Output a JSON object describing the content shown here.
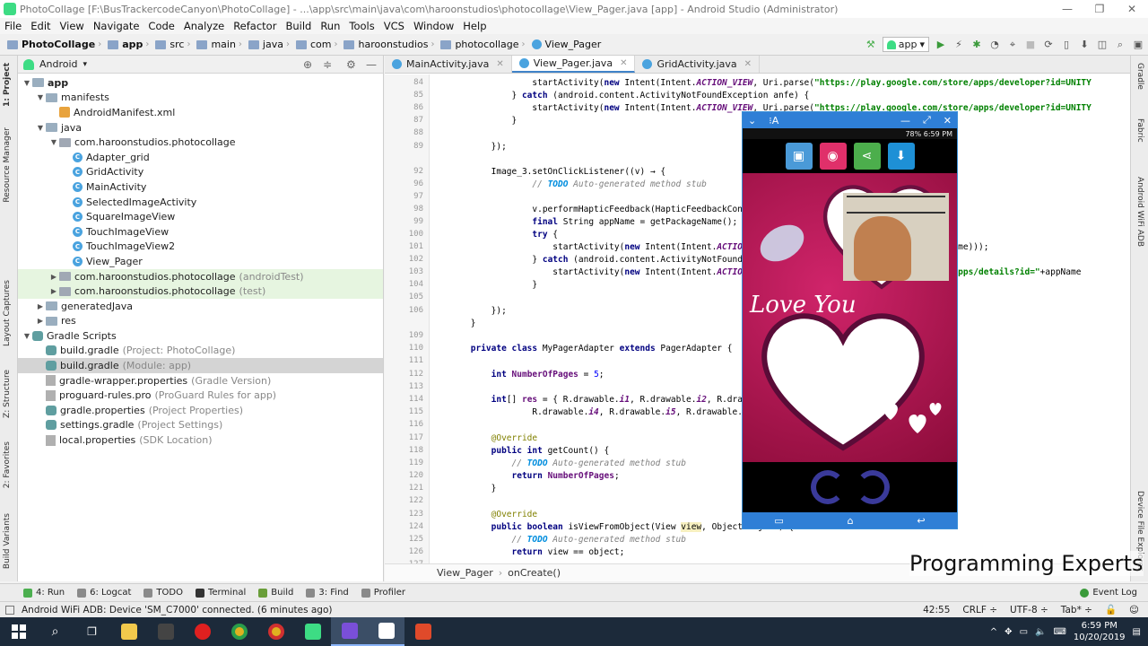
{
  "window": {
    "title": "PhotoCollage [F:\\BusTrackercodeCanyon\\PhotoCollage] - ...\\app\\src\\main\\java\\com\\haroonstudios\\photocollage\\View_Pager.java [app] - Android Studio (Administrator)",
    "controls": [
      "—",
      "❐",
      "✕"
    ]
  },
  "menu": [
    "File",
    "Edit",
    "View",
    "Navigate",
    "Code",
    "Analyze",
    "Refactor",
    "Build",
    "Run",
    "Tools",
    "VCS",
    "Window",
    "Help"
  ],
  "breadcrumb": [
    "PhotoCollage",
    "app",
    "src",
    "main",
    "java",
    "com",
    "haroonstudios",
    "photocollage",
    "View_Pager"
  ],
  "run_config": "app",
  "left_tabs": [
    "1: Project",
    "Resource Manager",
    "Layout Captures",
    "Z: Structure",
    "2: Favorites",
    "Build Variants"
  ],
  "right_tabs": [
    "Gradle",
    "Fabric",
    "Android WiFi ADB",
    "Device File Explorer"
  ],
  "project": {
    "view": "Android",
    "tree": [
      {
        "label": "app",
        "depth": 0,
        "type": "folder",
        "bold": true
      },
      {
        "label": "manifests",
        "depth": 1,
        "type": "folder"
      },
      {
        "label": "AndroidManifest.xml",
        "depth": 2,
        "type": "xml"
      },
      {
        "label": "java",
        "depth": 1,
        "type": "folder"
      },
      {
        "label": "com.haroonstudios.photocollage",
        "depth": 2,
        "type": "package"
      },
      {
        "label": "Adapter_grid",
        "depth": 3,
        "type": "class"
      },
      {
        "label": "GridActivity",
        "depth": 3,
        "type": "class"
      },
      {
        "label": "MainActivity",
        "depth": 3,
        "type": "class"
      },
      {
        "label": "SelectedImageActivity",
        "depth": 3,
        "type": "class"
      },
      {
        "label": "SquareImageView",
        "depth": 3,
        "type": "class"
      },
      {
        "label": "TouchImageView",
        "depth": 3,
        "type": "class"
      },
      {
        "label": "TouchImageView2",
        "depth": 3,
        "type": "class"
      },
      {
        "label": "View_Pager",
        "depth": 3,
        "type": "class"
      },
      {
        "label": "com.haroonstudios.photocollage",
        "hint": "(androidTest)",
        "depth": 2,
        "type": "package",
        "test": true
      },
      {
        "label": "com.haroonstudios.photocollage",
        "hint": "(test)",
        "depth": 2,
        "type": "package",
        "test": true
      },
      {
        "label": "generatedJava",
        "depth": 1,
        "type": "folder"
      },
      {
        "label": "res",
        "depth": 1,
        "type": "folder"
      },
      {
        "label": "Gradle Scripts",
        "depth": 0,
        "type": "gradlefolder"
      },
      {
        "label": "build.gradle",
        "hint": "(Project: PhotoCollage)",
        "depth": 1,
        "type": "gradle"
      },
      {
        "label": "build.gradle",
        "hint": "(Module: app)",
        "depth": 1,
        "type": "gradle",
        "selected": true
      },
      {
        "label": "gradle-wrapper.properties",
        "hint": "(Gradle Version)",
        "depth": 1,
        "type": "prop"
      },
      {
        "label": "proguard-rules.pro",
        "hint": "(ProGuard Rules for app)",
        "depth": 1,
        "type": "prop"
      },
      {
        "label": "gradle.properties",
        "hint": "(Project Properties)",
        "depth": 1,
        "type": "gradle"
      },
      {
        "label": "settings.gradle",
        "hint": "(Project Settings)",
        "depth": 1,
        "type": "gradle"
      },
      {
        "label": "local.properties",
        "hint": "(SDK Location)",
        "depth": 1,
        "type": "prop"
      }
    ]
  },
  "editor": {
    "tabs": [
      {
        "label": "MainActivity.java",
        "active": false
      },
      {
        "label": "View_Pager.java",
        "active": true
      },
      {
        "label": "GridActivity.java",
        "active": false
      }
    ],
    "line_numbers": [
      "84",
      "85",
      "86",
      "87",
      "88",
      "89",
      "92",
      "96",
      "97",
      "98",
      "99",
      "100",
      "101",
      "102",
      "103",
      "104",
      "105",
      "106",
      "109",
      "110",
      "111",
      "112",
      "113",
      "114",
      "115",
      "116",
      "117",
      "118",
      "119",
      "120",
      "121",
      "122",
      "123",
      "124",
      "125",
      "126",
      "127"
    ],
    "breadcrumb": [
      "View_Pager",
      "onCreate()"
    ]
  },
  "phone": {
    "window_title": "⁝A",
    "status": "78% 6:59 PM",
    "love_text": "Love You",
    "nav": [
      "▭",
      "⌂",
      "↩"
    ]
  },
  "watermark": "Programming Experts",
  "bottom_tabs": [
    "4: Run",
    "6: Logcat",
    "TODO",
    "Terminal",
    "Build",
    "3: Find",
    "Profiler"
  ],
  "event_log": "Event Log",
  "status": {
    "message": "Android WiFi ADB: Device 'SM_C7000' connected. (6 minutes ago)",
    "position": "42:55",
    "line_sep": "CRLF ÷",
    "encoding": "UTF-8 ÷",
    "indent": "Tab* ÷"
  },
  "taskbar": {
    "time": "6:59 PM",
    "date": "10/20/2019"
  }
}
